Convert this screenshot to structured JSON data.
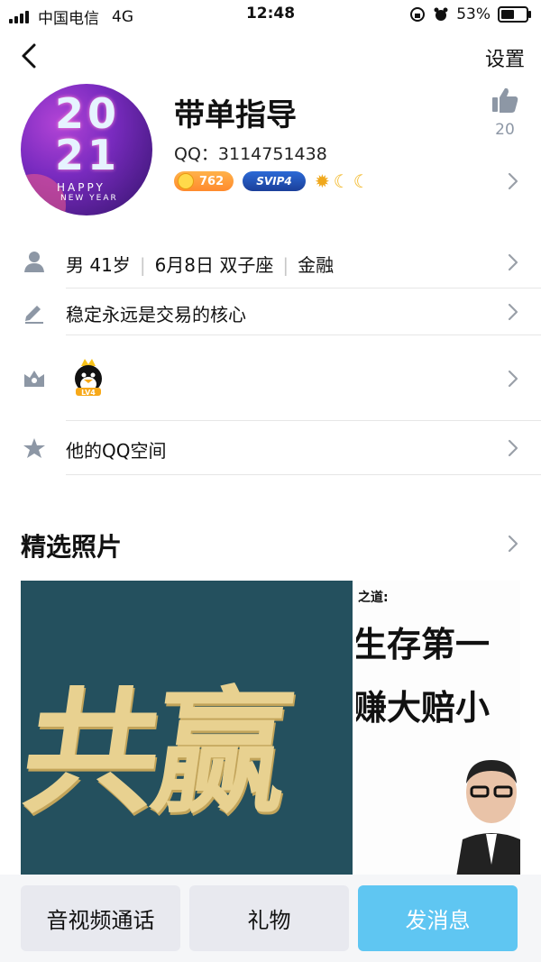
{
  "status_bar": {
    "carrier": "中国电信",
    "network": "4G",
    "time": "12:48",
    "battery": "53%"
  },
  "nav": {
    "settings_label": "设置"
  },
  "profile": {
    "avatar_text": {
      "year_top": "20",
      "year_bottom": "21",
      "line1": "HAPPY",
      "line2": "NEW YEAR"
    },
    "name": "带单指导",
    "qq_label": "QQ：3114751438",
    "coin_badge": "762",
    "svip_badge": "SVIP4",
    "like_count": "20"
  },
  "rows": {
    "info": {
      "gender_age": "男 41岁",
      "birthday": "6月8日 双子座",
      "industry": "金融"
    },
    "signature": "稳定永远是交易的核心",
    "qzone": "他的QQ空间"
  },
  "photos": {
    "title": "精选照片",
    "photo1_text": "共赢",
    "photo2_line0": "之道:",
    "photo2_line1": "生存第一",
    "photo2_line2": "赚大赔小"
  },
  "actions": {
    "call": "音视频通话",
    "gift": "礼物",
    "message": "发消息"
  },
  "colors": {
    "accent": "#5fc6f2",
    "icon_gray": "#8d97a5"
  }
}
